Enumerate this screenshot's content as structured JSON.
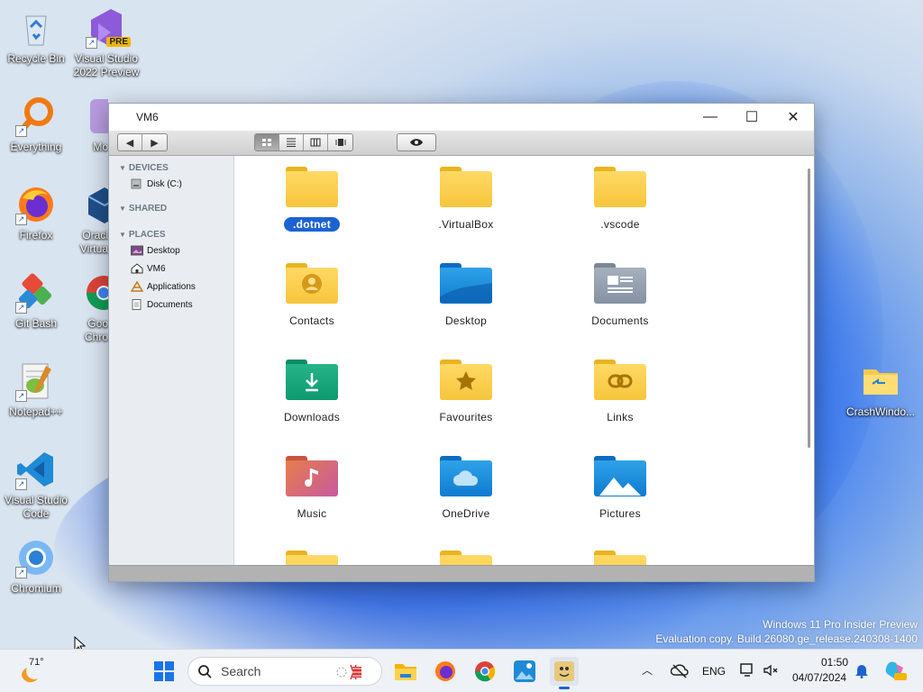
{
  "desktop": {
    "icons": [
      {
        "label": "Recycle Bin"
      },
      {
        "label": "Visual Studio 2022 Preview",
        "badge": "PRE"
      },
      {
        "label": "Everything"
      },
      {
        "label": "Mo"
      },
      {
        "label": "Firefox"
      },
      {
        "label": "Oracl Virtua"
      },
      {
        "label": "Git Bash"
      },
      {
        "label": "Goo Chro"
      },
      {
        "label": "Notepad++"
      },
      {
        "label": "Visual Studio Code"
      },
      {
        "label": "Chromium"
      },
      {
        "label": "CrashWindo..."
      }
    ],
    "watermark_line1": "Windows 11 Pro Insider Preview",
    "watermark_line2": "Evaluation copy. Build 26080.ge_release.240308-1400"
  },
  "window": {
    "title": "VM6",
    "minimize": "—",
    "maximize": "☐",
    "close": "✕",
    "sidebar": {
      "devices_header": "DEVICES",
      "devices": [
        {
          "label": "Disk (C:)"
        }
      ],
      "shared_header": "SHARED",
      "places_header": "PLACES",
      "places": [
        {
          "label": "Desktop"
        },
        {
          "label": "VM6"
        },
        {
          "label": "Applications"
        },
        {
          "label": "Documents"
        }
      ]
    },
    "files": [
      {
        "name": ".dotnet",
        "selected": true
      },
      {
        "name": ".VirtualBox"
      },
      {
        "name": ".vscode"
      },
      {
        "name": "Contacts"
      },
      {
        "name": "Desktop"
      },
      {
        "name": "Documents"
      },
      {
        "name": "Downloads"
      },
      {
        "name": "Favourites"
      },
      {
        "name": "Links"
      },
      {
        "name": "Music"
      },
      {
        "name": "OneDrive"
      },
      {
        "name": "Pictures"
      }
    ]
  },
  "taskbar": {
    "weather_temp": "71°",
    "search_placeholder": "Search",
    "language": "ENG",
    "time": "01:50",
    "date": "04/07/2024"
  }
}
